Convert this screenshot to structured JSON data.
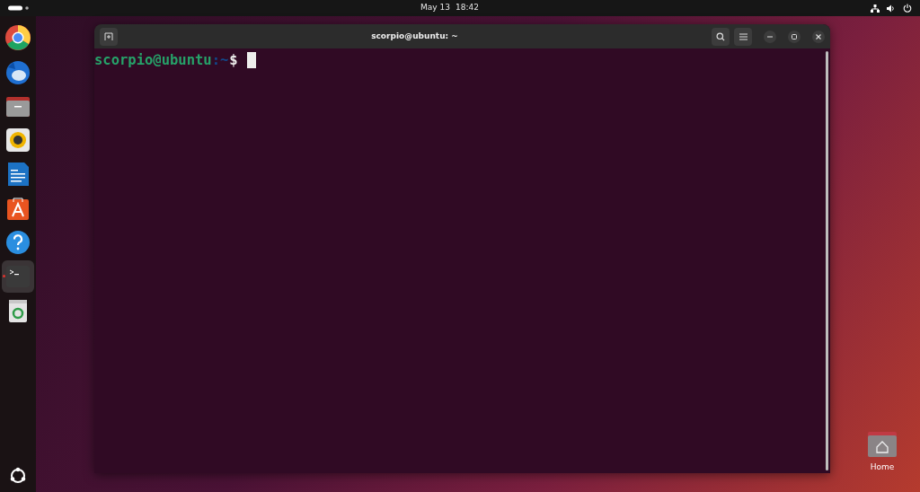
{
  "top_bar": {
    "clock_date": "May 13",
    "clock_time": "18:42"
  },
  "dock": {
    "items": [
      {
        "kind": "chrome",
        "selected": false,
        "running": false
      },
      {
        "kind": "thunderbird",
        "selected": false,
        "running": false
      },
      {
        "kind": "files",
        "selected": false,
        "running": false
      },
      {
        "kind": "rhythmbox",
        "selected": false,
        "running": false
      },
      {
        "kind": "writer",
        "selected": false,
        "running": false
      },
      {
        "kind": "appcenter",
        "selected": false,
        "running": false
      },
      {
        "kind": "help",
        "selected": false,
        "running": false
      },
      {
        "kind": "terminal",
        "selected": true,
        "running": true
      },
      {
        "kind": "trash",
        "selected": false,
        "running": false
      }
    ]
  },
  "window": {
    "title": "scorpio@ubuntu: ~",
    "prompt": {
      "user_host": "scorpio@ubuntu",
      "path": ":~",
      "symbol": "$"
    }
  },
  "desktop": {
    "icons": [
      {
        "label": "Home"
      }
    ]
  }
}
